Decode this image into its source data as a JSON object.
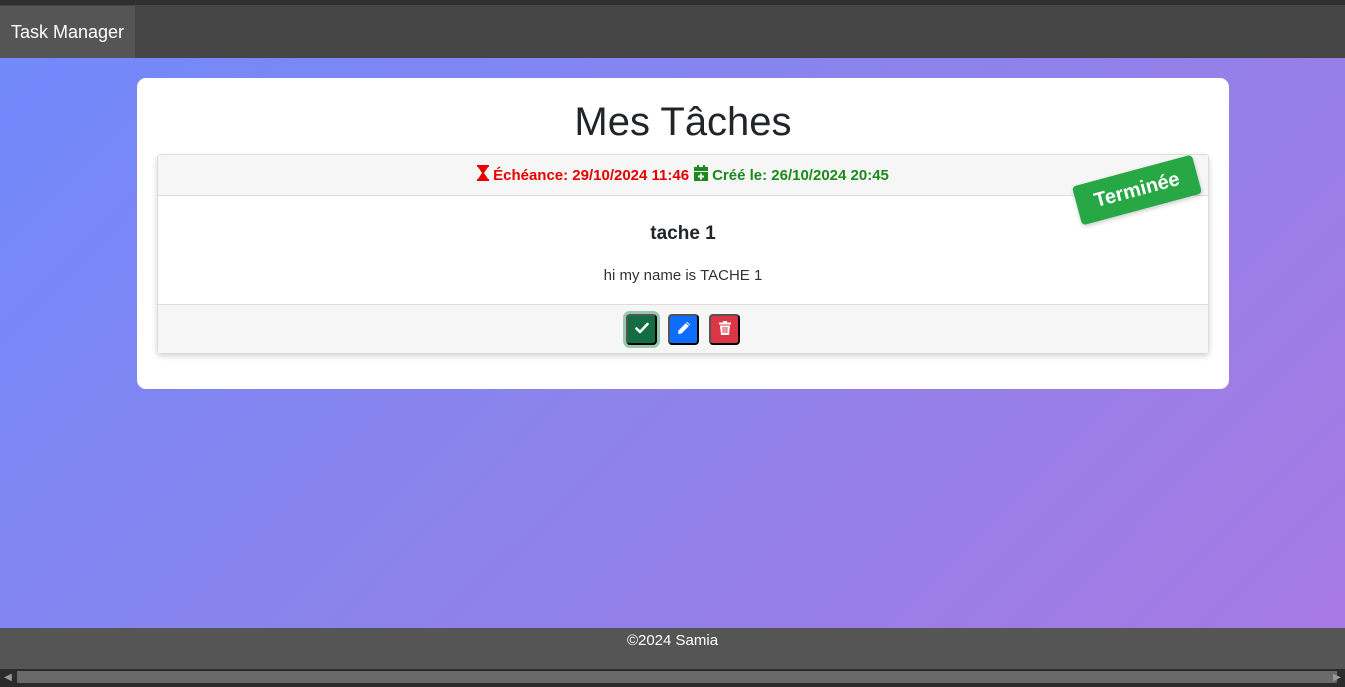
{
  "navbar": {
    "brand": "Task Manager"
  },
  "page": {
    "title": "Mes Tâches"
  },
  "task": {
    "deadline_text": "Échéance: 29/10/2024 11:46",
    "created_text": "Créé le: 26/10/2024 20:45",
    "title": "tache 1",
    "description": "hi my name is TACHE 1",
    "status": "Terminée",
    "colors": {
      "deadline": "#e60000",
      "created": "#1a8a1a",
      "status": "#28a745"
    },
    "icons": {
      "deadline": "hourglass-icon",
      "created": "calendar-plus-icon"
    },
    "actions": [
      {
        "name": "mark-done",
        "icon": "check-icon",
        "color": "#146c43"
      },
      {
        "name": "edit",
        "icon": "pencil-icon",
        "color": "#0d6efd"
      },
      {
        "name": "delete",
        "icon": "trash-icon",
        "color": "#dc3545"
      }
    ]
  },
  "footer": {
    "text": "©2024 Samia"
  }
}
